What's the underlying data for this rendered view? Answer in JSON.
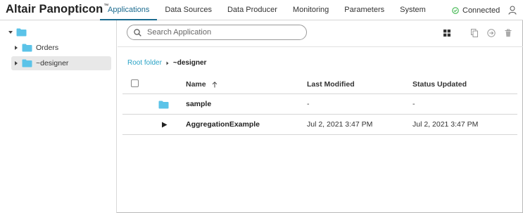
{
  "app": {
    "brand": "Altair Panopticon",
    "trademark": "™"
  },
  "nav": {
    "tabs": [
      {
        "label": "Applications",
        "active": true
      },
      {
        "label": "Data Sources",
        "active": false
      },
      {
        "label": "Data Producer",
        "active": false
      },
      {
        "label": "Monitoring",
        "active": false
      },
      {
        "label": "Parameters",
        "active": false
      },
      {
        "label": "System",
        "active": false
      }
    ],
    "status": {
      "label": "Connected",
      "color": "#3bb54a"
    }
  },
  "sidebar": {
    "items": [
      {
        "label": "",
        "icon": "folder-icon",
        "expanded": true
      },
      {
        "label": "Orders",
        "icon": "folder-icon",
        "expanded": false
      },
      {
        "label": "~designer",
        "icon": "folder-icon",
        "expanded": false,
        "selected": true
      }
    ]
  },
  "search": {
    "placeholder": "Search Application",
    "value": ""
  },
  "toolbar": {
    "icons": [
      "grid-view-icon",
      "copy-icon",
      "move-icon",
      "delete-icon"
    ]
  },
  "breadcrumb": {
    "root": "Root folder",
    "current": "~designer"
  },
  "table": {
    "headers": {
      "name": "Name",
      "last_modified": "Last Modified",
      "status_updated": "Status Updated"
    },
    "rows": [
      {
        "icon": "folder-icon",
        "name": "sample",
        "last_modified": "-",
        "status_updated": "-"
      },
      {
        "icon": "play-icon",
        "name": "AggregationExample",
        "last_modified": "Jul 2, 2021 3:47 PM",
        "status_updated": "Jul 2, 2021 3:47 PM"
      }
    ]
  },
  "colors": {
    "accent": "#1b6b8f",
    "link": "#2aa3c6",
    "folder": "#5bc3e8",
    "connected": "#3bb54a"
  }
}
